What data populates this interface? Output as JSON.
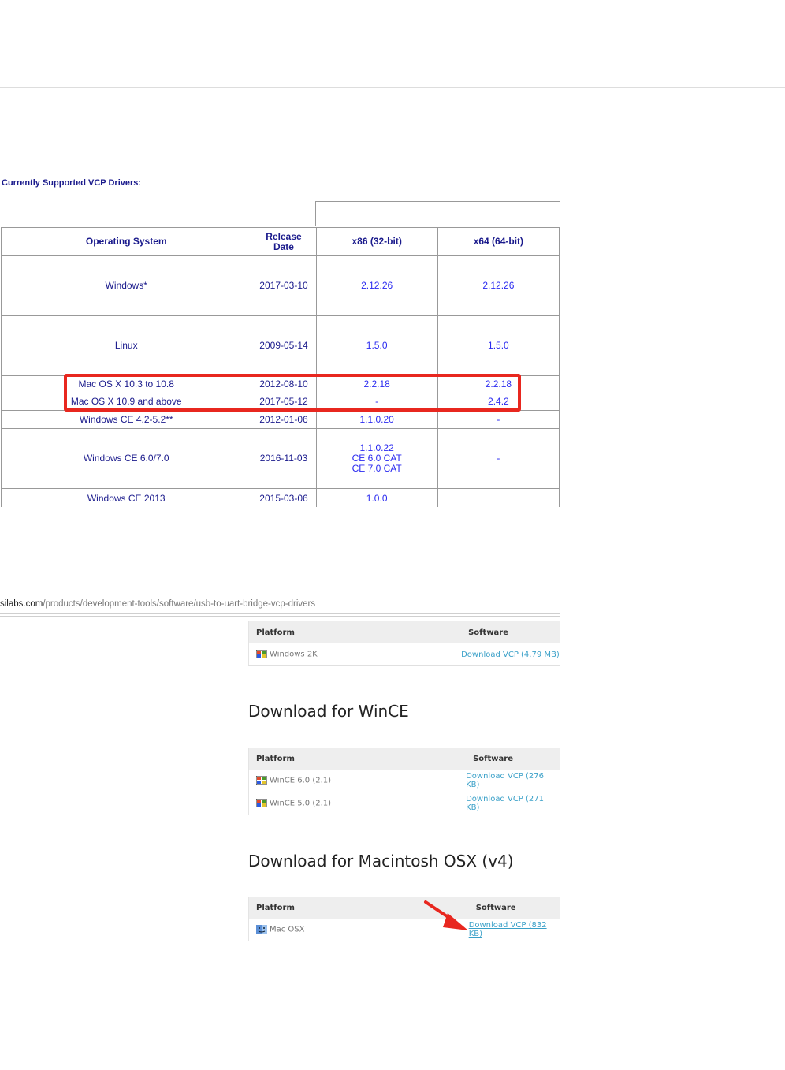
{
  "vcp": {
    "title": "Currently Supported VCP Drivers:",
    "headers": [
      "Operating System",
      "Release Date",
      "x86 (32-bit)",
      "x64 (64-bit)"
    ],
    "rows": [
      {
        "os": "Windows*",
        "date": "2017-03-10",
        "x86": "2.12.26",
        "x64": "2.12.26"
      },
      {
        "os": "Linux",
        "date": "2009-05-14",
        "x86": "1.5.0",
        "x64": "1.5.0"
      },
      {
        "os": "Mac OS X 10.3 to 10.8",
        "date": "2012-08-10",
        "x86": "2.2.18",
        "x64": "2.2.18"
      },
      {
        "os": "Mac OS X 10.9 and above",
        "date": "2017-05-12",
        "x86": "-",
        "x64": "2.4.2"
      },
      {
        "os": "Windows CE 4.2-5.2**",
        "date": "2012-01-06",
        "x86": "1.1.0.20",
        "x64": "-"
      },
      {
        "os": "Windows CE 6.0/7.0",
        "date": "2016-11-03",
        "x86_lines": [
          "1.1.0.22",
          "CE 6.0 CAT",
          "CE 7.0 CAT"
        ],
        "x64": "-"
      },
      {
        "os": "Windows CE 2013",
        "date": "2015-03-06",
        "x86": "1.0.0",
        "x64": ""
      }
    ],
    "highlight_color": "#e8271f"
  },
  "url": {
    "host": "silabs.com",
    "path": "/products/development-tools/software/usb-to-uart-bridge-vcp-drivers"
  },
  "win2k": {
    "headers": {
      "platform": "Platform",
      "software": "Software"
    },
    "rows": [
      {
        "platform": "Windows 2K",
        "software": "Download VCP (4.79 MB)"
      }
    ]
  },
  "wince": {
    "heading": "Download for WinCE",
    "headers": {
      "platform": "Platform",
      "software": "Software"
    },
    "rows": [
      {
        "platform": "WinCE 6.0 (2.1)",
        "software": "Download VCP (276 KB)"
      },
      {
        "platform": "WinCE 5.0 (2.1)",
        "software": "Download VCP (271 KB)"
      }
    ]
  },
  "mac": {
    "heading": "Download for Macintosh OSX (v4)",
    "headers": {
      "platform": "Platform",
      "software": "Software"
    },
    "rows": [
      {
        "platform": "Mac OSX",
        "software": "Download VCP (832 KB)"
      }
    ]
  },
  "colors": {
    "link": "#3aa0c8",
    "arrow": "#e8271f",
    "table_text": "#1a1a8c",
    "table_link": "#2a2af0"
  },
  "icons": {
    "windows_platform": "windows-flag-icon",
    "mac_platform": "mac-finder-icon",
    "pointer": "red-arrow-icon"
  }
}
